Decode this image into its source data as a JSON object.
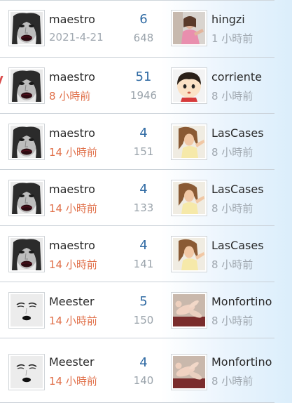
{
  "colors": {
    "reply_count": "#2f6aa3",
    "recent_time": "#e0704a",
    "old_time": "#a0a8b0",
    "divider": "#c8cfd6"
  },
  "rows": [
    {
      "author": {
        "name": "maestro",
        "time": "2021-4-21",
        "time_style": "gray",
        "avatar": "dark-lips-face-avatar"
      },
      "replies": "6",
      "views": "648",
      "last": {
        "name": "hingzi",
        "time": "1 小時前",
        "avatar": "pink-photo-avatar"
      }
    },
    {
      "author": {
        "name": "maestro",
        "time": "8 小時前",
        "time_style": "red",
        "avatar": "dark-lips-face-avatar"
      },
      "replies": "51",
      "views": "1946",
      "last": {
        "name": "corriente",
        "time": "8 小時前",
        "avatar": "cartoon-girl-avatar"
      }
    },
    {
      "author": {
        "name": "maestro",
        "time": "14 小時前",
        "time_style": "red",
        "avatar": "dark-lips-face-avatar"
      },
      "replies": "4",
      "views": "151",
      "last": {
        "name": "LasCases",
        "time": "8 小時前",
        "avatar": "woman-photo-avatar"
      }
    },
    {
      "author": {
        "name": "maestro",
        "time": "14 小時前",
        "time_style": "red",
        "avatar": "dark-lips-face-avatar"
      },
      "replies": "4",
      "views": "133",
      "last": {
        "name": "LasCases",
        "time": "8 小時前",
        "avatar": "woman-photo-avatar"
      }
    },
    {
      "author": {
        "name": "maestro",
        "time": "14 小時前",
        "time_style": "red",
        "avatar": "dark-lips-face-avatar"
      },
      "replies": "4",
      "views": "141",
      "last": {
        "name": "LasCases",
        "time": "8 小時前",
        "avatar": "woman-photo-avatar"
      }
    },
    {
      "author": {
        "name": "Meester",
        "time": "14 小時前",
        "time_style": "red",
        "avatar": "sketch-face-avatar"
      },
      "replies": "5",
      "views": "150",
      "last": {
        "name": "Monfortino",
        "time": "8 小時前",
        "avatar": "pink-figure-avatar"
      }
    },
    {
      "author": {
        "name": "Meester",
        "time": "14 小時前",
        "time_style": "red",
        "avatar": "sketch-face-avatar"
      },
      "replies": "4",
      "views": "140",
      "last": {
        "name": "Monfortino",
        "time": "8 小時前",
        "avatar": "pink-figure-avatar"
      }
    }
  ]
}
